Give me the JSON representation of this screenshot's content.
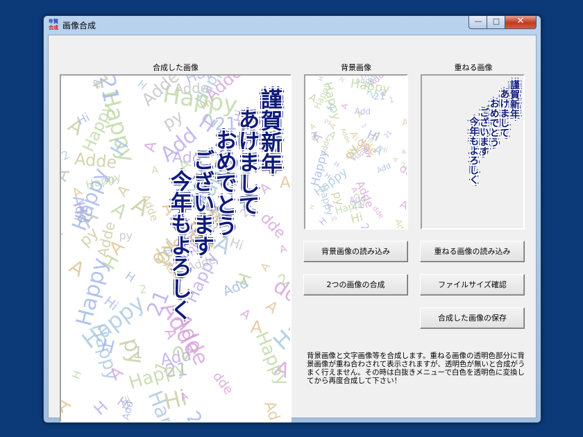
{
  "window": {
    "title": "画像合成",
    "icon_text_top": "年賀",
    "icon_text_bottom": "合成",
    "minimize_glyph": "—",
    "maximize_glyph": "□",
    "close_glyph": "✕"
  },
  "captions": {
    "composite": "合成した画像",
    "background": "背景画像",
    "overlay": "重ねる画像"
  },
  "greeting": {
    "columns": [
      "謹賀新年",
      "あけまして",
      "おめでとう",
      "ございます",
      "今年もよろしく"
    ]
  },
  "background_text": {
    "fragments": [
      "Happy",
      "A",
      "Hi",
      "Adde",
      "21",
      "Happy",
      "A",
      "dde",
      "H",
      "2",
      "Adde",
      "A",
      "Hi",
      "Happy",
      "1",
      "A",
      "Add",
      "H",
      "py",
      "A"
    ],
    "colors": [
      "#b9a7e8",
      "#a7c7e0",
      "#c9c9a0",
      "#d4a0d8",
      "#9fb4e8",
      "#bcd7a2",
      "#c0c0c0",
      "#e0c090"
    ]
  },
  "buttons": {
    "load_background": "背景画像の読み込み",
    "load_overlay": "重ねる画像の読み込み",
    "combine": "2つの画像の合成",
    "check_size": "ファイルサイズ確認",
    "save": "合成した画像の保存"
  },
  "description": "背景画像と文字画像等を合成します。重ねる画像の透明色部分に背景画像が重ね合わされて表示されますが、透明色が無いと合成がうまく行えません。その時は白抜きメニューで白色を透明色に変換してから再度合成して下さい！"
}
